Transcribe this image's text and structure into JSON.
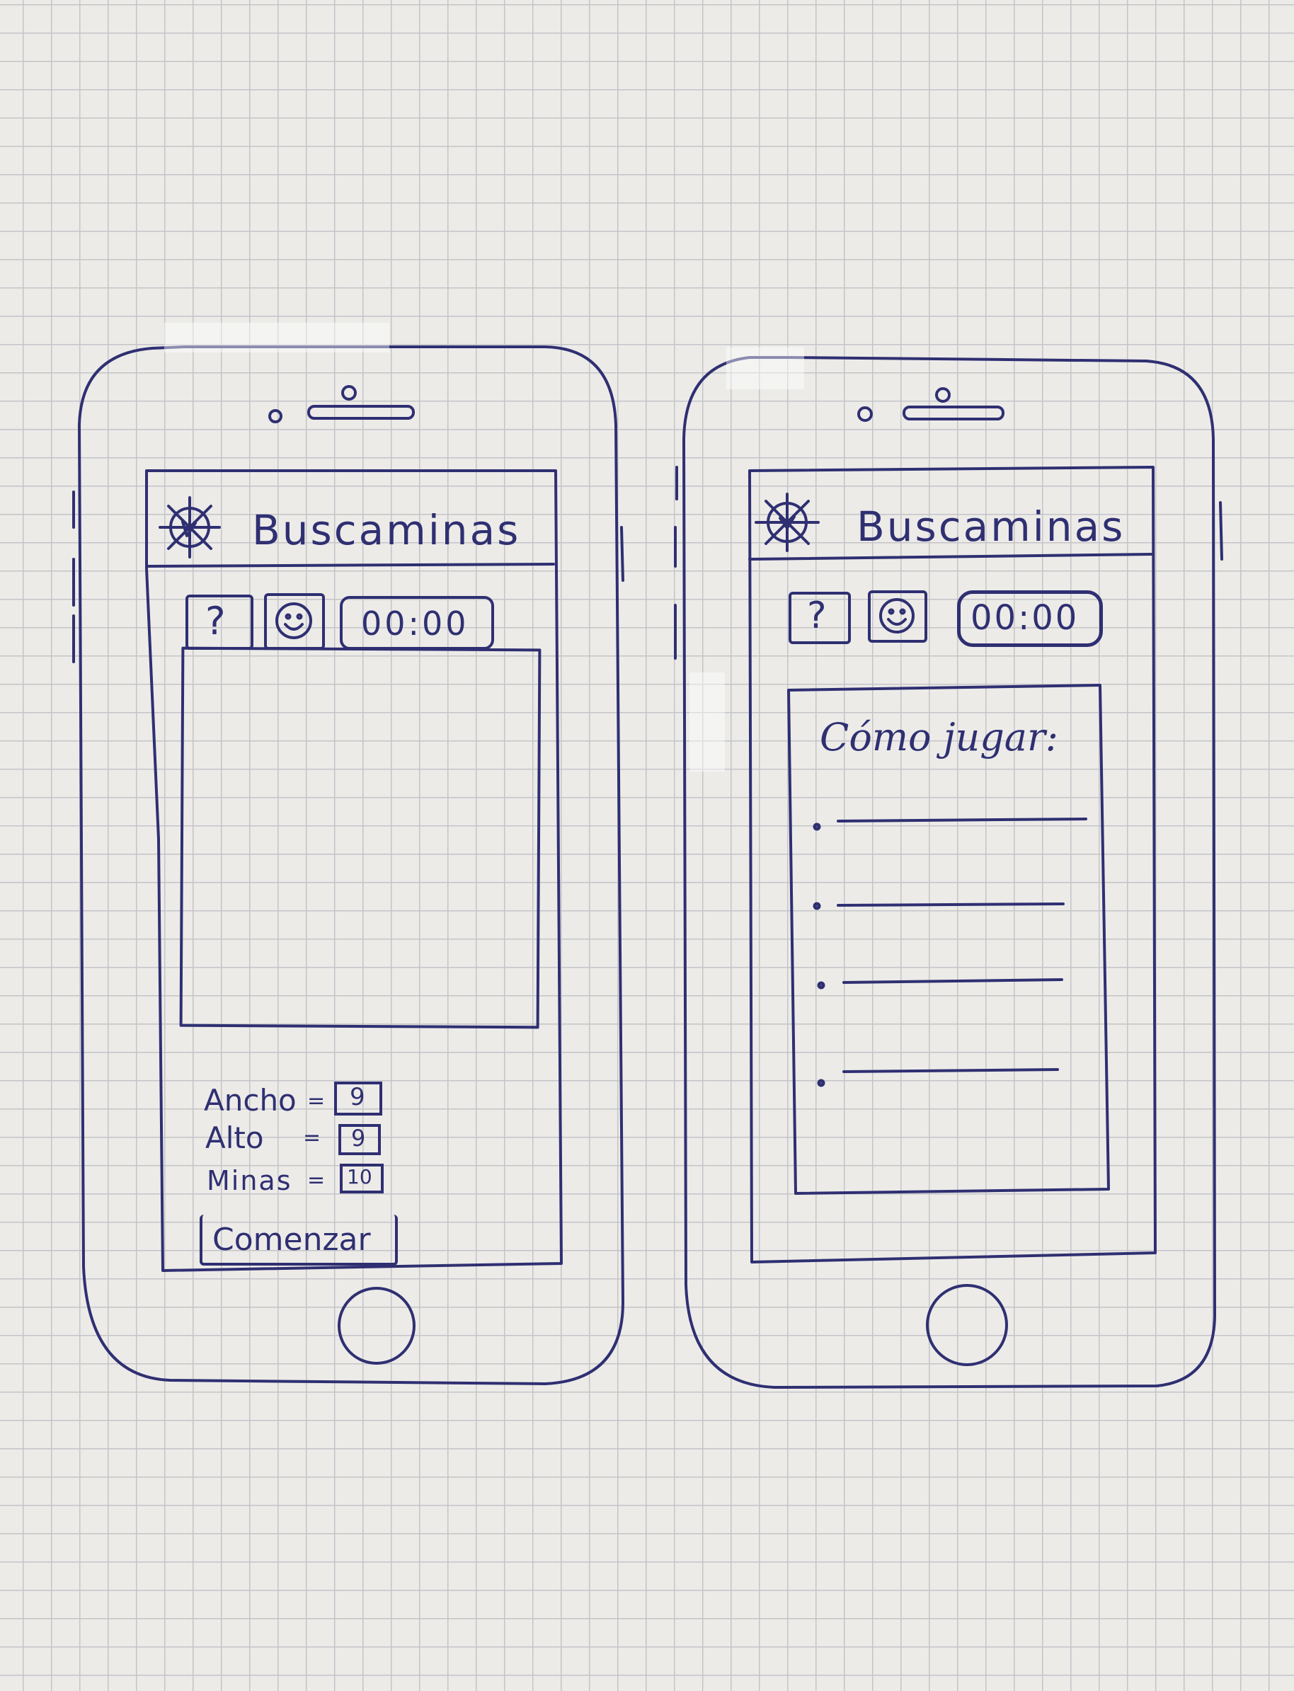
{
  "screens": [
    {
      "id": "game-setup",
      "app_title": "Buscaminas",
      "app_icon": "mine-icon",
      "toolbar": {
        "help_label": "?",
        "face_icon": "smiley-icon",
        "timer": "00:00"
      },
      "settings": [
        {
          "label": "Ancho",
          "separator": "=",
          "value": "9"
        },
        {
          "label": "Alto",
          "separator": "=",
          "value": "9"
        },
        {
          "label": "Minas",
          "separator": "=",
          "value": "10"
        }
      ],
      "start_label": "Comenzar"
    },
    {
      "id": "how-to-play",
      "app_title": "Buscaminas",
      "app_icon": "mine-icon",
      "toolbar": {
        "help_label": "?",
        "face_icon": "smiley-icon",
        "timer": "00:00"
      },
      "help_title": "Cómo jugar:",
      "bullet_count": 4
    }
  ],
  "colors": {
    "ink": "#2f2f72",
    "paper": "#ecebe8",
    "grid": "#c4c4c9"
  }
}
